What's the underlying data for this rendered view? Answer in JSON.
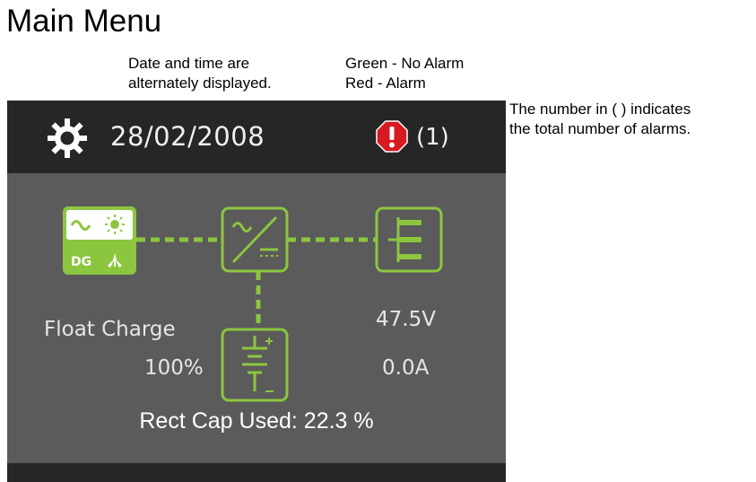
{
  "page": {
    "title": "Main Menu"
  },
  "notes": {
    "date_time": [
      "Date and time are",
      "alternately displayed."
    ],
    "alarm_colors": [
      "Green - No Alarm",
      "Red - Alarm"
    ],
    "alarm_count": [
      "The number in ( ) indicates",
      "the total number of alarms."
    ]
  },
  "screen": {
    "header": {
      "date": "28/02/2008",
      "alarm_count": "(1)",
      "settings_icon": "gear-icon",
      "alarm_icon": "alarm-warning-icon"
    },
    "diagram": {
      "input_top_symbols": "∿ ☀",
      "input_dg_label": "DG",
      "nodes": [
        "ac-solar-dg-input-icon",
        "rectifier-icon",
        "dc-distribution-icon",
        "battery-icon"
      ]
    },
    "status": {
      "charge_mode": "Float Charge",
      "battery_capacity": "100%",
      "voltage": "47.5V",
      "current": "0.0A",
      "rect_cap_used": "Rect Cap Used: 22.3 %"
    },
    "colors": {
      "screen_bg": "#5b5b5b",
      "header_bg": "#262626",
      "accent_green": "#8cc63f",
      "alarm_red": "#d71920"
    }
  }
}
